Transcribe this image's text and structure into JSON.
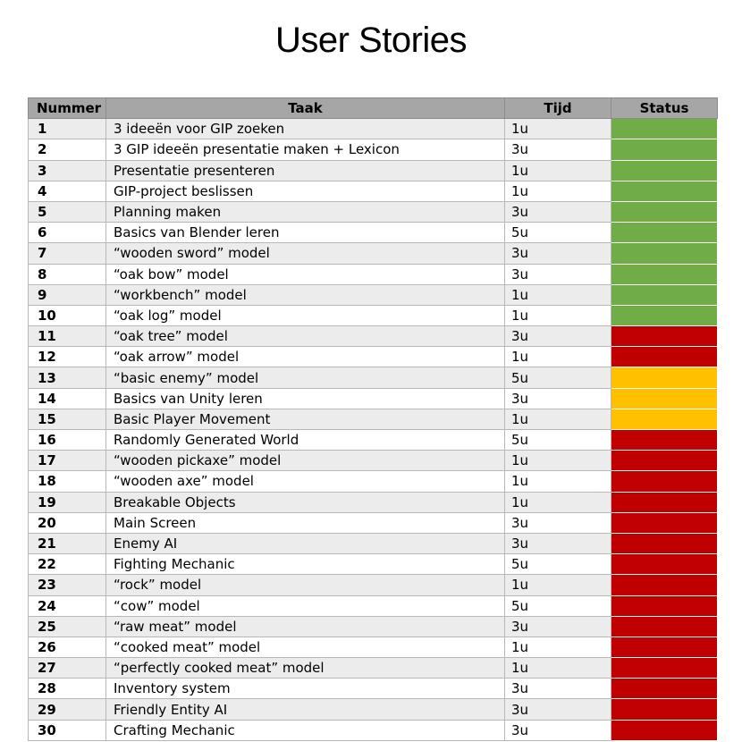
{
  "title": "User Stories",
  "headers": {
    "number": "Nummer",
    "task": "Taak",
    "time": "Tijd",
    "status": "Status"
  },
  "colors": {
    "done": "#70ad47",
    "not_started": "#c00000",
    "in_progress": "#ffc000"
  },
  "rows": [
    {
      "number": "1",
      "task": "3 ideeën voor GIP zoeken",
      "time": "1u",
      "status": "done"
    },
    {
      "number": "2",
      "task": "3 GIP ideeën presentatie maken + Lexicon",
      "time": "3u",
      "status": "done"
    },
    {
      "number": "3",
      "task": "Presentatie presenteren",
      "time": "1u",
      "status": "done"
    },
    {
      "number": "4",
      "task": "GIP-project beslissen",
      "time": "1u",
      "status": "done"
    },
    {
      "number": "5",
      "task": "Planning maken",
      "time": "3u",
      "status": "done"
    },
    {
      "number": "6",
      "task": "Basics van Blender leren",
      "time": "5u",
      "status": "done"
    },
    {
      "number": "7",
      "task": "“wooden sword” model",
      "time": "3u",
      "status": "done"
    },
    {
      "number": "8",
      "task": "“oak  bow” model",
      "time": "3u",
      "status": "done"
    },
    {
      "number": "9",
      "task": "“workbench” model",
      "time": "1u",
      "status": "done"
    },
    {
      "number": "10",
      "task": "“oak log” model",
      "time": "1u",
      "status": "done"
    },
    {
      "number": "11",
      "task": "“oak tree” model",
      "time": "3u",
      "status": "not_started"
    },
    {
      "number": "12",
      "task": "“oak arrow” model",
      "time": "1u",
      "status": "not_started"
    },
    {
      "number": "13",
      "task": "“basic enemy” model",
      "time": "5u",
      "status": "in_progress"
    },
    {
      "number": "14",
      "task": "Basics van Unity leren",
      "time": "3u",
      "status": "in_progress"
    },
    {
      "number": "15",
      "task": "Basic Player Movement",
      "time": "1u",
      "status": "in_progress"
    },
    {
      "number": "16",
      "task": "Randomly Generated World",
      "time": "5u",
      "status": "not_started"
    },
    {
      "number": "17",
      "task": "“wooden pickaxe” model",
      "time": "1u",
      "status": "not_started"
    },
    {
      "number": "18",
      "task": "“wooden axe” model",
      "time": "1u",
      "status": "not_started"
    },
    {
      "number": "19",
      "task": "Breakable Objects",
      "time": "1u",
      "status": "not_started"
    },
    {
      "number": "20",
      "task": "Main Screen",
      "time": "3u",
      "status": "not_started"
    },
    {
      "number": "21",
      "task": "Enemy AI",
      "time": "3u",
      "status": "not_started"
    },
    {
      "number": "22",
      "task": "Fighting Mechanic",
      "time": "5u",
      "status": "not_started"
    },
    {
      "number": "23",
      "task": "“rock” model",
      "time": "1u",
      "status": "not_started"
    },
    {
      "number": "24",
      "task": "“cow” model",
      "time": "5u",
      "status": "not_started"
    },
    {
      "number": "25",
      "task": "“raw meat” model",
      "time": "3u",
      "status": "not_started"
    },
    {
      "number": "26",
      "task": "“cooked meat” model",
      "time": "1u",
      "status": "not_started"
    },
    {
      "number": "27",
      "task": "“perfectly cooked meat” model",
      "time": "1u",
      "status": "not_started"
    },
    {
      "number": "28",
      "task": "Inventory system",
      "time": "3u",
      "status": "not_started"
    },
    {
      "number": "29",
      "task": "Friendly Entity AI",
      "time": "3u",
      "status": "not_started"
    },
    {
      "number": "30",
      "task": "Crafting Mechanic",
      "time": "3u",
      "status": "not_started"
    }
  ]
}
